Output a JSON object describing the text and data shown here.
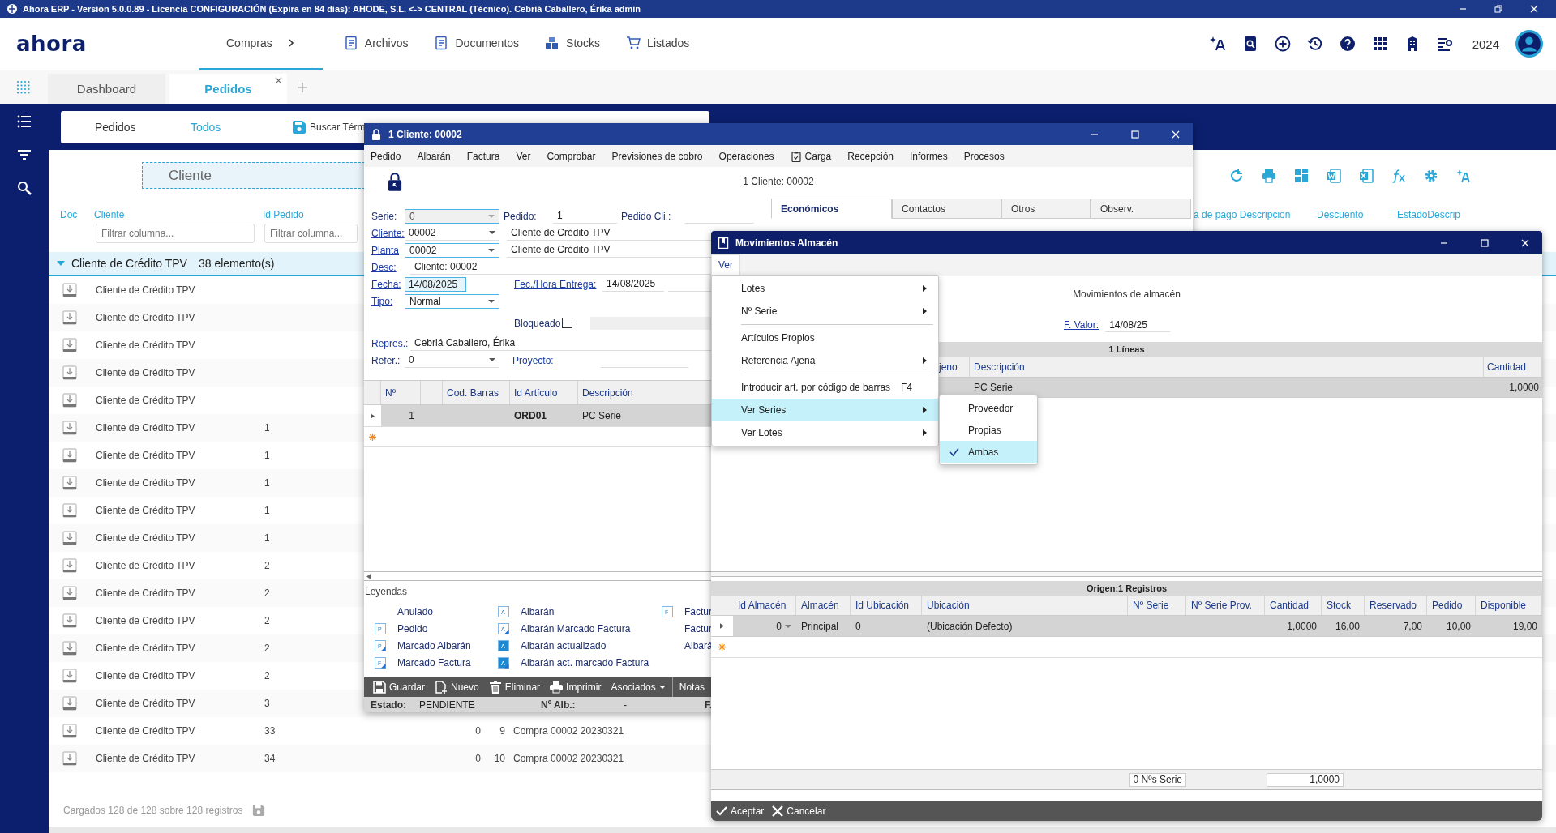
{
  "app_title": "Ahora ERP - Versión 5.0.0.89 - Licencia CONFIGURACIÓN (Expira en 84 días): AHODE, S.L. <-> CENTRAL (Técnico). Cebriá Caballero, Érika admin",
  "logo": "ahora",
  "nav": [
    {
      "label": "Compras",
      "selected": true,
      "submenu": true
    },
    {
      "label": "Archivos",
      "selected": false,
      "submenu": false
    },
    {
      "label": "Documentos",
      "selected": false,
      "submenu": false
    },
    {
      "label": "Stocks",
      "selected": false,
      "submenu": false
    },
    {
      "label": "Listados",
      "selected": false,
      "submenu": false
    }
  ],
  "year": "2024",
  "tabs": [
    {
      "label": "Dashboard",
      "selected": false,
      "closable": false
    },
    {
      "label": "Pedidos",
      "selected": true,
      "closable": true
    }
  ],
  "list": {
    "toolbar": {
      "title": "Pedidos",
      "filter": "Todos",
      "search": "Buscar Térm"
    },
    "group_panel": "Cliente",
    "columns": [
      {
        "label": "Doc"
      },
      {
        "label": "Cliente",
        "placeholder": "Filtrar columna..."
      },
      {
        "label": "Id Pedido",
        "placeholder": "Filtrar columna..."
      }
    ],
    "right_columns": [
      "a de pago Descripcion",
      "Descuento",
      "EstadoDescrip"
    ],
    "group": {
      "label": "Cliente de Crédito TPV",
      "count": "38 elemento(s)",
      "expanded": true
    },
    "rows": [
      {
        "cliente": "Cliente de Crédito TPV"
      },
      {
        "cliente": "Cliente de Crédito TPV"
      },
      {
        "cliente": "Cliente de Crédito TPV"
      },
      {
        "cliente": "Cliente de Crédito TPV"
      },
      {
        "cliente": "Cliente de Crédito TPV"
      },
      {
        "cliente": "Cliente de Crédito TPV",
        "column_3": "1"
      },
      {
        "cliente": "Cliente de Crédito TPV",
        "column_3": "1"
      },
      {
        "cliente": "Cliente de Crédito TPV",
        "column_3": "1"
      },
      {
        "cliente": "Cliente de Crédito TPV",
        "column_3": "1"
      },
      {
        "cliente": "Cliente de Crédito TPV",
        "column_3": "1"
      },
      {
        "cliente": "Cliente de Crédito TPV",
        "column_3": "2"
      },
      {
        "cliente": "Cliente de Crédito TPV",
        "column_3": "2"
      },
      {
        "cliente": "Cliente de Crédito TPV",
        "column_3": "2"
      },
      {
        "cliente": "Cliente de Crédito TPV",
        "column_3": "2"
      },
      {
        "cliente": "Cliente de Crédito TPV",
        "column_3": "2"
      },
      {
        "cliente": "Cliente de Crédito TPV",
        "column_3": "3"
      },
      {
        "cliente": "Cliente de Crédito TPV",
        "column_3": "33",
        "column_4": "0",
        "column_5": "9",
        "column_6": "Compra 00002 20230321"
      },
      {
        "cliente": "Cliente de Crédito TPV",
        "column_3": "34",
        "column_4": "0",
        "column_5": "10",
        "column_6": "Compra 00002 20230321"
      }
    ],
    "footer": "Cargados 128 de 128 sobre 128 registros"
  },
  "order_window": {
    "title": "1 Cliente: 00002",
    "menu": [
      {
        "label": "Pedido"
      },
      {
        "label": "Albarán"
      },
      {
        "label": "Factura"
      },
      {
        "label": "Ver"
      },
      {
        "label": "Comprobar"
      },
      {
        "label": "Previsiones de cobro"
      },
      {
        "label": "Operaciones"
      },
      {
        "label": "Carga"
      },
      {
        "label": "Recepción"
      },
      {
        "label": "Informes"
      },
      {
        "label": "Procesos"
      }
    ],
    "subtitle": "1 Cliente: 00002",
    "form": {
      "serie": {
        "label": "Serie:",
        "value": "0",
        "disabled": true
      },
      "pedido": {
        "label": "Pedido:",
        "value": "1"
      },
      "pedido_cli": {
        "label": "Pedido Cli.:"
      },
      "cliente": {
        "label": "Cliente:",
        "value": "00002",
        "name": "Cliente de Crédito TPV"
      },
      "planta": {
        "label": "Planta",
        "value": "00002",
        "name": "Cliente de Crédito TPV"
      },
      "desc": {
        "label": "Desc:",
        "value": "Cliente: 00002"
      },
      "fecha": {
        "label": "Fecha:",
        "value": "14/08/2025"
      },
      "entrega": {
        "label": "Fec./Hora Entrega:",
        "value": "14/08/2025"
      },
      "tipo": {
        "label": "Tipo:",
        "value": "Normal"
      },
      "bloqueado": {
        "label": "Bloqueado",
        "checked": false
      },
      "repres": {
        "label": "Repres.:",
        "value": "Cebriá Caballero, Érika"
      },
      "refer": {
        "label": "Refer.:",
        "value": "0"
      },
      "proyecto": {
        "label": "Proyecto:"
      }
    },
    "tabs": [
      {
        "label": "Económicos",
        "selected": true
      },
      {
        "label": "Contactos",
        "selected": false
      },
      {
        "label": "Otros",
        "selected": false
      },
      {
        "label": "Observ.",
        "selected": false
      }
    ],
    "grid": {
      "columns": [
        "Nº",
        "Cod. Barras",
        "Id Artículo",
        "Descripción"
      ],
      "rows": [
        {
          "n": "1",
          "id_articulo": "ORD01",
          "descripcion": "PC Serie",
          "selected": true
        }
      ]
    },
    "legend_title": "Leyendas",
    "legend": [
      [
        {
          "label": "Anulado"
        },
        {
          "label": "Pedido",
          "letter": "P",
          "filled": false,
          "corner": false
        },
        {
          "label": "Marcado Albarán",
          "letter": "P",
          "filled": false,
          "corner": true
        },
        {
          "label": "Marcado Factura",
          "letter": "F",
          "filled": false,
          "corner": true
        }
      ],
      [
        {
          "label": "Albarán",
          "letter": "A",
          "filled": false,
          "corner": false
        },
        {
          "label": "Albarán Marcado Factura",
          "letter": "A",
          "filled": false,
          "corner": true
        },
        {
          "label": "Albarán actualizado",
          "letter": "A",
          "filled": true,
          "corner": false
        },
        {
          "label": "Albarán act. marcado Factura",
          "letter": "A",
          "filled": true,
          "corner": true
        }
      ],
      [
        {
          "label": "Factur",
          "letter": "F",
          "filled": false,
          "corner": false
        },
        {
          "label": "Factur"
        },
        {
          "label": "Albará"
        }
      ]
    ],
    "actions": [
      {
        "label": "Guardar",
        "kind": "save"
      },
      {
        "label": "Nuevo",
        "kind": "new"
      },
      {
        "label": "Eliminar",
        "kind": "delete"
      },
      {
        "label": "Imprimir",
        "kind": "print"
      },
      {
        "label": "Asociados",
        "kind": "dropdown"
      },
      {
        "label": "Notas",
        "kind": "text"
      }
    ],
    "status": [
      {
        "label": "Estado:",
        "value": "PENDIENTE"
      },
      {
        "label": "Nº Alb.:",
        "value": "-"
      },
      {
        "label": "F."
      }
    ]
  },
  "stock_window": {
    "title": "Movimientos Almacén",
    "menu": [
      {
        "label": "Ver",
        "open": true
      }
    ],
    "heading": "Movimientos de almacén",
    "valor": {
      "label": "F. Valor:",
      "value": "14/08/25"
    },
    "lines": {
      "title": "1 Líneas",
      "columns": [
        "jeno",
        "Descripción",
        "Cantidad"
      ],
      "rows": [
        {
          "descripcion": "PC Serie",
          "cantidad": "1,0000",
          "selected": true
        }
      ]
    },
    "origin": {
      "title": "Origen:1 Registros",
      "columns": [
        "Id Almacén",
        "Almacén",
        "Id Ubicación",
        "Ubicación",
        "Nº Serie",
        "Nº Serie Prov.",
        "Cantidad",
        "Stock",
        "Reservado",
        "Pedido",
        "Disponible"
      ],
      "rows": [
        {
          "selected": true,
          "cells": [
            "0",
            "Principal",
            "0",
            "(Ubicación Defecto)",
            null,
            null,
            "1,0000",
            "16,00",
            "7,00",
            "10,00",
            "19,00"
          ]
        }
      ]
    },
    "footer": {
      "serials": "0 Nºs Serie",
      "total": "1,0000"
    },
    "buttons": [
      {
        "label": "Aceptar",
        "kind": "accept"
      },
      {
        "label": "Cancelar",
        "kind": "cancel"
      }
    ],
    "dropdown": [
      {
        "items": [
          {
            "label": "Lotes",
            "submenu": true,
            "selected": false
          },
          {
            "label": "Nº Serie",
            "submenu": true,
            "selected": false
          }
        ]
      },
      {
        "items": [
          {
            "label": "Artículos Propios",
            "submenu": false,
            "selected": false
          },
          {
            "label": "Referencia Ajena",
            "submenu": true,
            "selected": false
          }
        ]
      },
      {
        "items": [
          {
            "label": "Introducir art. por código de barras",
            "shortcut": "F4",
            "submenu": false,
            "selected": false
          },
          {
            "label": "Ver Series",
            "submenu": true,
            "selected": true
          },
          {
            "label": "Ver Lotes",
            "submenu": true,
            "selected": false
          }
        ]
      }
    ],
    "submenu": [
      {
        "label": "Proveedor",
        "checked": false,
        "selected": false
      },
      {
        "label": "Propias",
        "checked": false,
        "selected": false
      },
      {
        "label": "Ambas",
        "checked": true,
        "selected": true
      }
    ]
  }
}
